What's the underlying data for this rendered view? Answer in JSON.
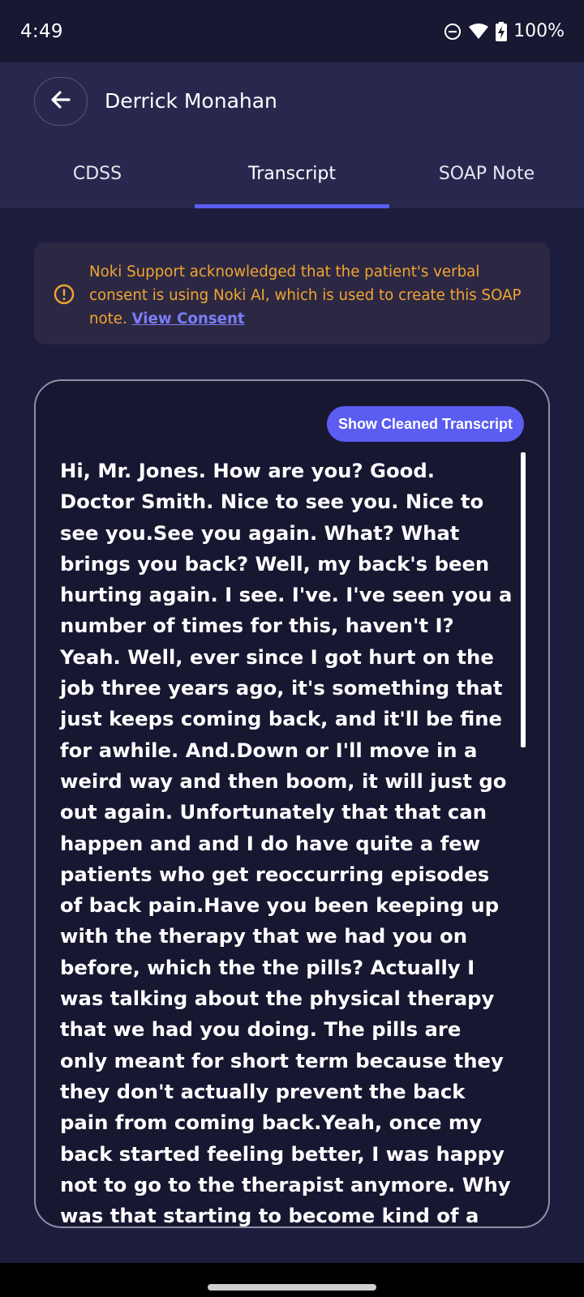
{
  "status_bar": {
    "time": "4:49",
    "battery": "100%",
    "icons": [
      "do-not-disturb-icon",
      "wifi-icon",
      "battery-charging-icon"
    ]
  },
  "header": {
    "back_icon": "arrow-left-icon",
    "title": "Derrick Monahan"
  },
  "tabs": [
    {
      "label": "CDSS",
      "active": false
    },
    {
      "label": "Transcript",
      "active": true
    },
    {
      "label": "SOAP Note",
      "active": false
    }
  ],
  "consent_notice": {
    "icon": "info-icon",
    "text": "Noki Support acknowledged that the patient's verbal consent is using Noki AI, which is used to create this SOAP note. ",
    "link_label": "View Consent"
  },
  "transcript": {
    "toggle_label": "Show Cleaned Transcript",
    "text": "Hi, Mr. Jones. How are you? Good. Doctor Smith. Nice to see you. Nice to see you.See you again. What? What brings you back? Well, my back's been hurting again. I see. I've. I've seen you a number of times for this, haven't I? Yeah. Well, ever since I got hurt on the job three years ago, it's something that just keeps coming back, and it'll be fine for awhile. And.Down or I'll move in a weird way and then boom, it will just go out again. Unfortunately that that can happen and and I do have quite a few patients who get reoccurring episodes of back pain.Have you been keeping up with the therapy that we had you on before, which the the pills? Actually I was talking about the physical therapy that we had you doing. The pills are only meant for short term because they they don't actually prevent the back pain from coming back.Yeah, once my back started feeling better, I was happy not to go to the therapist anymore. Why was that starting to become kind of a hassle?You know, with my work schedule and the cost"
  },
  "colors": {
    "background": "#1c1c3d",
    "header": "#28284f",
    "accent": "#5a5cf2",
    "warning": "#f2a52e"
  }
}
